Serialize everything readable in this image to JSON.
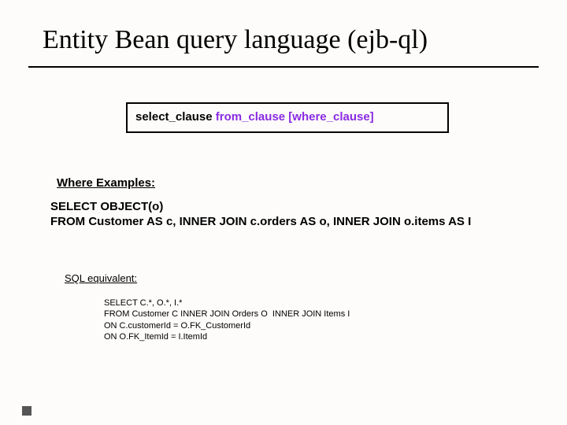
{
  "title": "Entity Bean query language (ejb-ql)",
  "syntax": {
    "select": "select_clause ",
    "rest": "from_clause [where_clause]"
  },
  "where_header": "Where Examples:",
  "ejbql": {
    "line1": "SELECT OBJECT(o)",
    "line2": "FROM Customer AS c, INNER JOIN c.orders AS o, INNER JOIN o.items AS I"
  },
  "sql_header": "SQL equivalent:",
  "sql": {
    "line1": "SELECT C.*, O.*, I.*",
    "line2": "FROM Customer C INNER JOIN Orders O  INNER JOIN Items I",
    "line3": "ON C.customerId = O.FK_CustomerId",
    "line4": "ON O.FK_ItemId = I.ItemId"
  }
}
